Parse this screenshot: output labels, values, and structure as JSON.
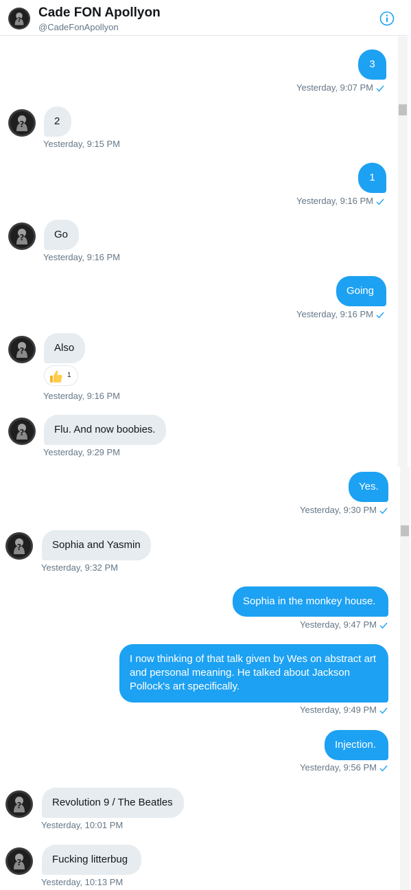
{
  "header": {
    "name": "Cade FON Apollyon",
    "handle": "@CadeFonApollyon",
    "info_icon": "info-icon",
    "accent": "#1da1f2"
  },
  "messages": [
    {
      "dir": "out",
      "text": "3",
      "time": "Yesterday, 9:07 PM"
    },
    {
      "dir": "in",
      "text": "2",
      "time": "Yesterday, 9:15 PM"
    },
    {
      "dir": "out",
      "text": "1",
      "time": "Yesterday, 9:16 PM"
    },
    {
      "dir": "in",
      "text": "Go",
      "time": "Yesterday, 9:16 PM"
    },
    {
      "dir": "out",
      "text": "Going",
      "time": "Yesterday, 9:16 PM"
    },
    {
      "dir": "in",
      "text": "Also",
      "time": "Yesterday, 9:16 PM",
      "reaction": {
        "emoji": "thumbs-up",
        "count": "1"
      }
    },
    {
      "dir": "in",
      "text": "Flu. And now boobies.",
      "time": "Yesterday, 9:29 PM"
    },
    {
      "dir": "out",
      "text": "Yes.",
      "time": "Yesterday, 9:30 PM"
    },
    {
      "dir": "in",
      "text": "Sophia and Yasmin",
      "time": "Yesterday, 9:32 PM"
    },
    {
      "dir": "out",
      "text": "Sophia in the monkey house.",
      "time": "Yesterday, 9:47 PM"
    },
    {
      "dir": "out",
      "text": "I now thinking of that talk given by Wes on abstract art and personal meaning. He talked about Jackson Pollock's art specifically.",
      "time": "Yesterday, 9:49 PM"
    },
    {
      "dir": "out",
      "text": "Injection.",
      "time": "Yesterday, 9:56 PM"
    },
    {
      "dir": "in",
      "text": "Revolution 9 / The Beatles",
      "time": "Yesterday, 10:01 PM"
    },
    {
      "dir": "in",
      "text": "Fucking litterbug",
      "time": "Yesterday, 10:13 PM"
    }
  ]
}
